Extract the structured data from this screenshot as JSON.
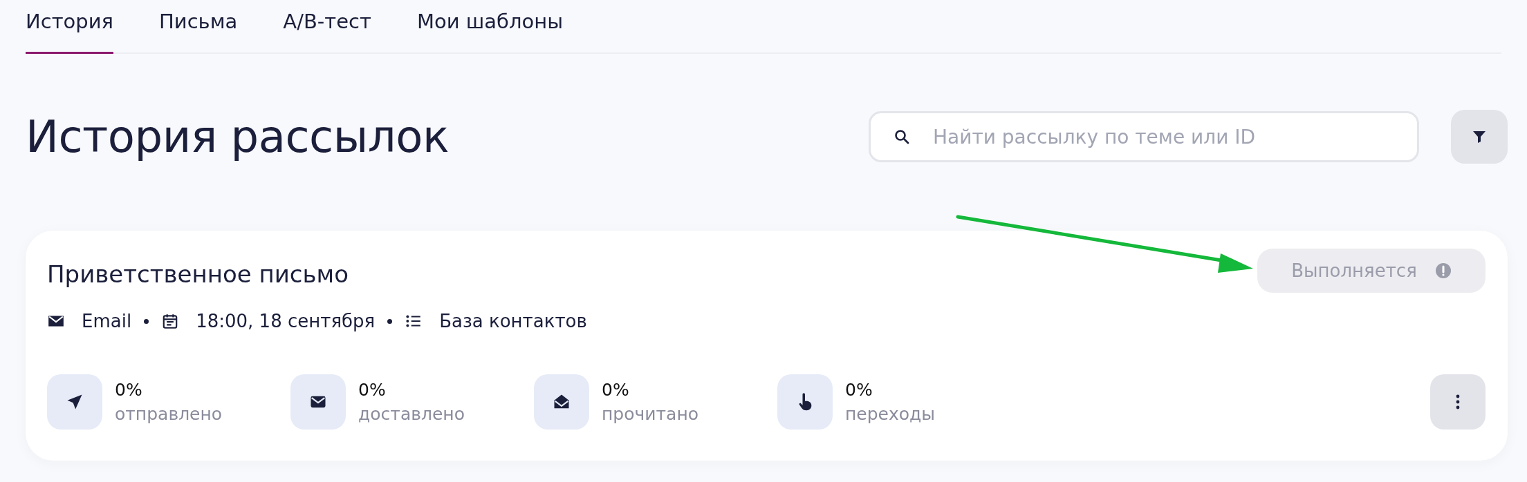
{
  "tabs": [
    {
      "label": "История",
      "selected": true
    },
    {
      "label": "Письма",
      "selected": false
    },
    {
      "label": "A/B-тест",
      "selected": false
    },
    {
      "label": "Мои шаблоны",
      "selected": false
    }
  ],
  "page_title": "История рассылок",
  "search": {
    "placeholder": "Найти рассылку по теме или ID"
  },
  "campaign": {
    "title": "Приветственное письмо",
    "status": "Выполняется",
    "meta": [
      {
        "kind": "channel",
        "text": "Email"
      },
      {
        "kind": "date",
        "text": "18:00, 18 сентября"
      },
      {
        "kind": "audience",
        "text": "База контактов"
      }
    ],
    "stats": [
      {
        "kind": "sent",
        "value": "0%",
        "label": "отправлено"
      },
      {
        "kind": "delivered",
        "value": "0%",
        "label": "доставлено"
      },
      {
        "kind": "read",
        "value": "0%",
        "label": "прочитано"
      },
      {
        "kind": "clicks",
        "value": "0%",
        "label": "переходы"
      }
    ]
  }
}
